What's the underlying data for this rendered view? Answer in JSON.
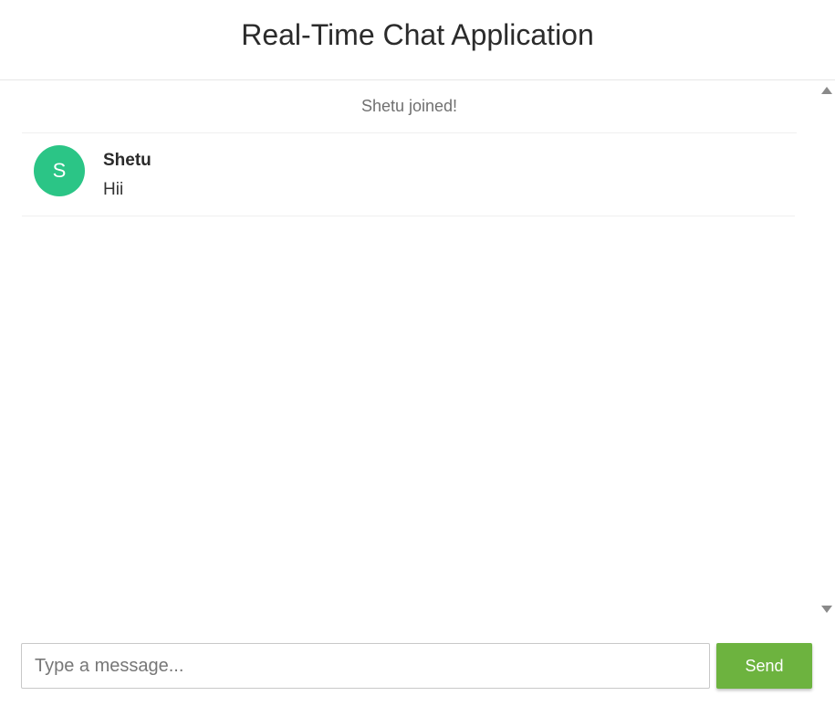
{
  "header": {
    "title": "Real-Time Chat Application"
  },
  "messages": {
    "event": {
      "text": "Shetu joined!"
    },
    "chat": [
      {
        "avatar_letter": "S",
        "avatar_color": "#2bc586",
        "sender": "Shetu",
        "text": "Hii"
      }
    ]
  },
  "composer": {
    "placeholder": "Type a message...",
    "value": "",
    "send_label": "Send",
    "send_color": "#6db33f"
  },
  "icons": {
    "scroll_up": "triangle-up-icon",
    "scroll_down": "triangle-down-icon"
  }
}
